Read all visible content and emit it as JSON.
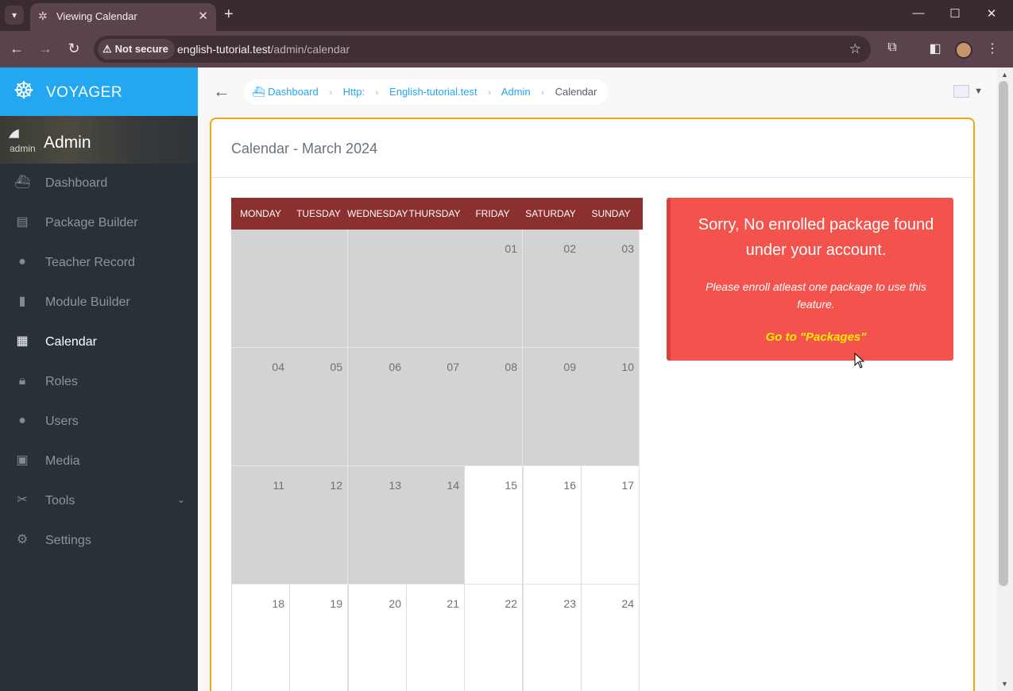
{
  "browser": {
    "tab_title": "Viewing Calendar",
    "security_label": "Not secure",
    "url_host": "english-tutorial.test",
    "url_path": "/admin/calendar"
  },
  "sidebar": {
    "brand": "VOYAGER",
    "user_name": "Admin",
    "avatar_alt": "admin",
    "items": [
      {
        "label": "Dashboard",
        "icon": "boat-icon"
      },
      {
        "label": "Package Builder",
        "icon": "wallet-icon"
      },
      {
        "label": "Teacher Record",
        "icon": "person-icon"
      },
      {
        "label": "Module Builder",
        "icon": "book-icon"
      },
      {
        "label": "Calendar",
        "icon": "calendar-icon",
        "active": true
      },
      {
        "label": "Roles",
        "icon": "lock-icon"
      },
      {
        "label": "Users",
        "icon": "person-icon"
      },
      {
        "label": "Media",
        "icon": "images-icon"
      },
      {
        "label": "Tools",
        "icon": "tools-icon",
        "has_submenu": true
      },
      {
        "label": "Settings",
        "icon": "gear-icon"
      }
    ]
  },
  "breadcrumb": {
    "items": [
      "Dashboard",
      "Http:",
      "English-tutorial.test",
      "Admin"
    ],
    "current": "Calendar"
  },
  "panel": {
    "title": "Calendar - March 2024"
  },
  "calendar": {
    "days_of_week": [
      "MONDAY",
      "TUESDAY",
      "WEDNESDAY",
      "THURSDAY",
      "FRIDAY",
      "SATURDAY",
      "SUNDAY"
    ],
    "weeks": [
      [
        "",
        "",
        "",
        "",
        "01",
        "02",
        "03"
      ],
      [
        "04",
        "05",
        "06",
        "07",
        "08",
        "09",
        "10"
      ],
      [
        "11",
        "12",
        "13",
        "14",
        "15",
        "16",
        "17"
      ],
      [
        "18",
        "19",
        "20",
        "21",
        "22",
        "23",
        "24"
      ]
    ],
    "past_until_index": 17
  },
  "alert": {
    "title": "Sorry, No enrolled package found under your account.",
    "message": "Please enroll atleast one package to use this feature.",
    "link": "Go to \"Packages\""
  },
  "colors": {
    "brand": "#22a7f0",
    "calendar_header": "#8b2f2f",
    "alert_bg": "#f4524d",
    "alert_link": "#ffec00",
    "panel_border": "#f0a70f"
  }
}
